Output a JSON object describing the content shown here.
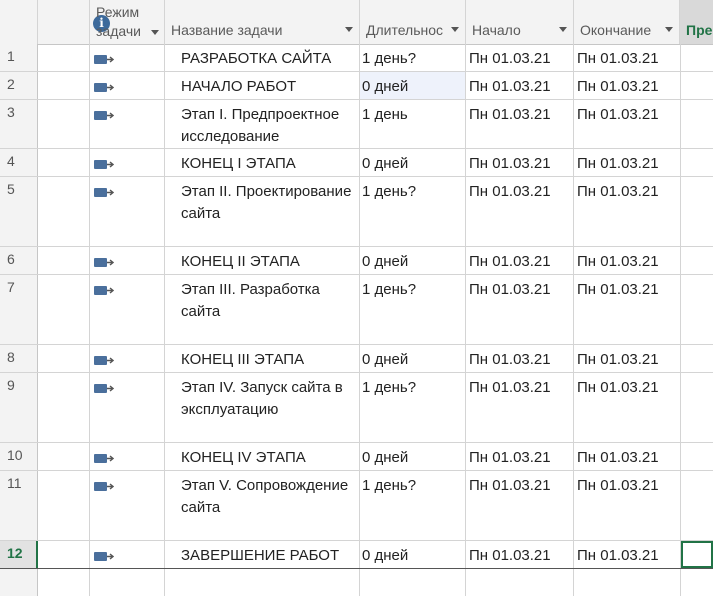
{
  "header": {
    "info_icon": "info-icon",
    "mode_line1": "Режим",
    "mode_line2": "задачи",
    "name": "Название задачи",
    "duration": "Длительнос",
    "start": "Начало",
    "end": "Окончание",
    "predecessors": "Пре"
  },
  "rows": [
    {
      "num": "1",
      "name": "РАЗРАБОТКА САЙТА",
      "duration": "1 день?",
      "start": "Пн 01.03.21",
      "end": "Пн 01.03.21"
    },
    {
      "num": "2",
      "name": "НАЧАЛО РАБОТ",
      "duration": "0 дней",
      "start": "Пн 01.03.21",
      "end": "Пн 01.03.21"
    },
    {
      "num": "3",
      "name": "Этап I. Предпроектное исследование",
      "duration": "1 день",
      "start": "Пн 01.03.21",
      "end": "Пн 01.03.21"
    },
    {
      "num": "4",
      "name": "КОНЕЦ I ЭТАПА",
      "duration": "0 дней",
      "start": "Пн 01.03.21",
      "end": "Пн 01.03.21"
    },
    {
      "num": "5",
      "name": "Этап II. Проектирование сайта",
      "duration": "1 день?",
      "start": "Пн 01.03.21",
      "end": "Пн 01.03.21"
    },
    {
      "num": "6",
      "name": "КОНЕЦ II ЭТАПА",
      "duration": "0 дней",
      "start": "Пн 01.03.21",
      "end": "Пн 01.03.21"
    },
    {
      "num": "7",
      "name": "Этап III. Разработка сайта",
      "duration": "1 день?",
      "start": "Пн 01.03.21",
      "end": "Пн 01.03.21"
    },
    {
      "num": "8",
      "name": "КОНЕЦ III ЭТАПА",
      "duration": "0 дней",
      "start": "Пн 01.03.21",
      "end": "Пн 01.03.21"
    },
    {
      "num": "9",
      "name": "Этап IV. Запуск сайта в эксплуатацию",
      "duration": "1 день?",
      "start": "Пн 01.03.21",
      "end": "Пн 01.03.21"
    },
    {
      "num": "10",
      "name": "КОНЕЦ IV ЭТАПА",
      "duration": "0 дней",
      "start": "Пн 01.03.21",
      "end": "Пн 01.03.21"
    },
    {
      "num": "11",
      "name": "Этап V. Сопровождение сайта",
      "duration": "1 день?",
      "start": "Пн 01.03.21",
      "end": "Пн 01.03.21"
    },
    {
      "num": "12",
      "name": "ЗАВЕРШЕНИЕ РАБОТ",
      "duration": "0 дней",
      "start": "Пн 01.03.21",
      "end": "Пн 01.03.21"
    }
  ],
  "colors": {
    "accent": "#217346",
    "header_bg": "#f3f3f3",
    "info_icon": "#3d6a9b"
  }
}
